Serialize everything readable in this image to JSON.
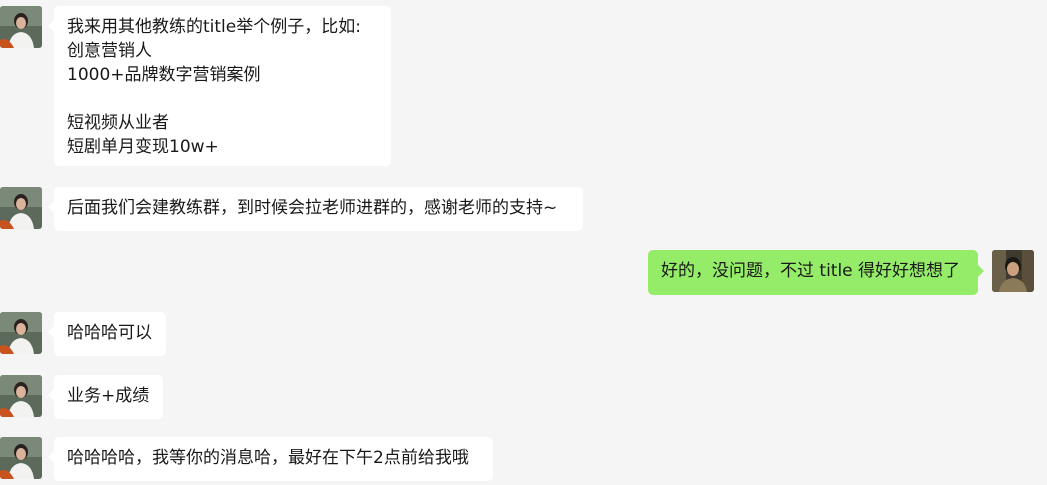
{
  "messages": [
    {
      "sender": "other",
      "avatar": "contact-avatar",
      "text": "我来用其他教练的title举个例子，比如:\n创意营销人\n1000+品牌数字营销案例\n\n短视频从业者\n短剧单月变现10w+"
    },
    {
      "sender": "other",
      "avatar": "contact-avatar",
      "text": "后面我们会建教练群，到时候会拉老师进群的，感谢老师的支持~"
    },
    {
      "sender": "self",
      "avatar": "self-avatar",
      "text": "好的，没问题，不过 title 得好好想想了"
    },
    {
      "sender": "other",
      "avatar": "contact-avatar",
      "text": "哈哈哈可以"
    },
    {
      "sender": "other",
      "avatar": "contact-avatar",
      "text": "业务+成绩"
    },
    {
      "sender": "other",
      "avatar": "contact-avatar",
      "text": "哈哈哈哈，我等你的消息哈，最好在下午2点前给我哦"
    }
  ],
  "colors": {
    "background": "#f5f5f5",
    "incoming_bubble": "#ffffff",
    "outgoing_bubble": "#95ec69",
    "text": "#191919"
  }
}
